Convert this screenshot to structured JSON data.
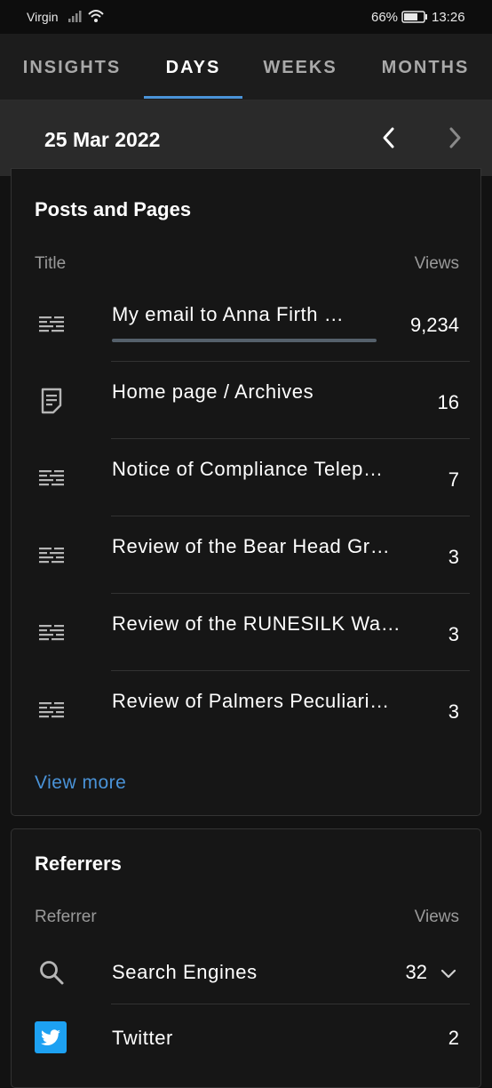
{
  "status_bar": {
    "carrier": "Virgin",
    "battery": "66%",
    "time": "13:26"
  },
  "tabs": [
    {
      "label": "INSIGHTS",
      "active": false
    },
    {
      "label": "DAYS",
      "active": true
    },
    {
      "label": "WEEKS",
      "active": false
    },
    {
      "label": "MONTHS",
      "active": false
    }
  ],
  "date_nav": {
    "date": "25 Mar 2022"
  },
  "posts": {
    "title": "Posts and Pages",
    "col_title": "Title",
    "col_views": "Views",
    "rows": [
      {
        "icon": "post-icon",
        "title": "My email to Anna Firth …",
        "views": "9,234",
        "bar_fraction": 1.0
      },
      {
        "icon": "page-icon",
        "title": "Home page / Archives",
        "views": "16"
      },
      {
        "icon": "post-icon",
        "title": "Notice of Compliance Telep…",
        "views": "7"
      },
      {
        "icon": "post-icon",
        "title": "Review of the Bear Head Gr…",
        "views": "3"
      },
      {
        "icon": "post-icon",
        "title": "Review of the RUNESILK Wa…",
        "views": "3"
      },
      {
        "icon": "post-icon",
        "title": "Review of Palmers Peculiari…",
        "views": "3"
      }
    ],
    "view_more": "View more"
  },
  "referrers": {
    "title": "Referrers",
    "col_referrer": "Referrer",
    "col_views": "Views",
    "rows": [
      {
        "icon": "search-icon",
        "name": "Search Engines",
        "views": "32"
      },
      {
        "icon": "twitter-icon",
        "name": "Twitter",
        "views": "2"
      }
    ]
  },
  "colors": {
    "accent": "#4a93d8",
    "background": "#121212",
    "card": "#161616",
    "twitter": "#1da1f2"
  }
}
